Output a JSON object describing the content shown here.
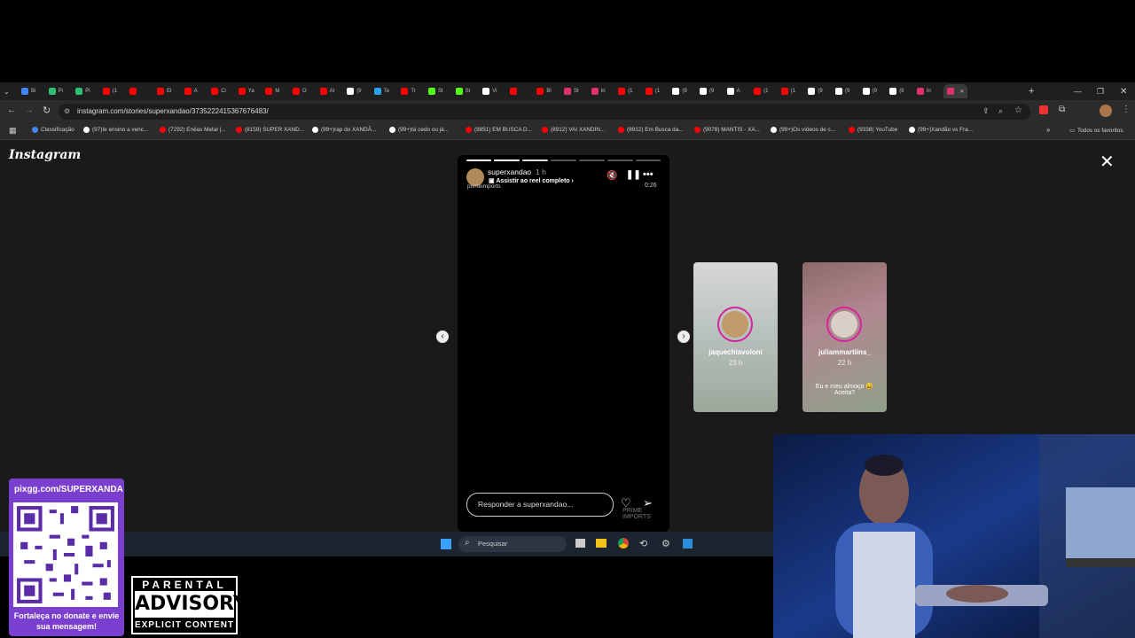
{
  "browser": {
    "tabs": [
      {
        "label": "Bi",
        "color": "#4285f4"
      },
      {
        "label": "Pi",
        "color": "#2fbf71"
      },
      {
        "label": "Pi",
        "color": "#2fbf71"
      },
      {
        "label": "(1",
        "color": "#ff0000"
      },
      {
        "label": "",
        "color": "#ff0000"
      },
      {
        "label": "El",
        "color": "#ff0000"
      },
      {
        "label": "A",
        "color": "#ff0000"
      },
      {
        "label": "Ci",
        "color": "#ff0000"
      },
      {
        "label": "Ya",
        "color": "#ff0000"
      },
      {
        "label": "M",
        "color": "#ff0000"
      },
      {
        "label": "O",
        "color": "#ff0000"
      },
      {
        "label": "Al",
        "color": "#ff0000"
      },
      {
        "label": "(9",
        "color": "#ffffff"
      },
      {
        "label": "Te",
        "color": "#2aa3ef"
      },
      {
        "label": "Tr",
        "color": "#ff0000"
      },
      {
        "label": "St",
        "color": "#53fc18"
      },
      {
        "label": "St",
        "color": "#53fc18"
      },
      {
        "label": "Vi",
        "color": "#ffffff"
      },
      {
        "label": "",
        "color": "#ff0000"
      },
      {
        "label": "Bl",
        "color": "#ff0000"
      },
      {
        "label": "St",
        "color": "#e1306c"
      },
      {
        "label": "In",
        "color": "#e1306c"
      },
      {
        "label": "(1",
        "color": "#ff0000"
      },
      {
        "label": "(1",
        "color": "#ff0000"
      },
      {
        "label": "(9",
        "color": "#ffffff"
      },
      {
        "label": "(9",
        "color": "#ffffff"
      },
      {
        "label": "A",
        "color": "#ffffff"
      },
      {
        "label": "(1",
        "color": "#ff0000"
      },
      {
        "label": "(1",
        "color": "#ff0000"
      },
      {
        "label": "(9",
        "color": "#ffffff"
      },
      {
        "label": "(9",
        "color": "#ffffff"
      },
      {
        "label": "(9",
        "color": "#ffffff"
      },
      {
        "label": "(9",
        "color": "#ffffff"
      },
      {
        "label": "In",
        "color": "#e1306c"
      },
      {
        "label": "",
        "color": "#e1306c"
      }
    ],
    "url": "instagram.com/stories/superxandao/3735222415367676483/",
    "bookmarks": [
      {
        "label": "Classificação",
        "color": "#4285f4"
      },
      {
        "label": "(97)Ie ensino a venc...",
        "color": "#ffffff"
      },
      {
        "label": "(7292) Enéas Metal |...",
        "color": "#ff0000"
      },
      {
        "label": "(8159) SUPER XAND...",
        "color": "#ff0000"
      },
      {
        "label": "(99+)rap do XANDÃ...",
        "color": "#ffffff"
      },
      {
        "label": "(99+)tá cedo ou já...",
        "color": "#ffffff"
      },
      {
        "label": "(8851) EM BUSCA D...",
        "color": "#ff0000"
      },
      {
        "label": "(8912) VAI XANDIN...",
        "color": "#ff0000"
      },
      {
        "label": "(8912) Em Busca da...",
        "color": "#ff0000"
      },
      {
        "label": "(9078) MANTIS - XA...",
        "color": "#ff0000"
      },
      {
        "label": "(99+)Os vídeos de c...",
        "color": "#ffffff"
      },
      {
        "label": "(9338) YouTube",
        "color": "#ff0000"
      },
      {
        "label": "(99+)Xandão vs Fra...",
        "color": "#ffffff"
      }
    ],
    "all_favorites": "Todos os favoritos"
  },
  "instagram": {
    "logo": "Instagram",
    "story": {
      "username": "superxandao",
      "time_ago": "1 h",
      "reel_link": "Assistir ao reel completo",
      "sponsor_text": "primeimports",
      "elapsed": "0:26",
      "reply_placeholder": "Responder a superxandao...",
      "watermark": "PRIME IMPORTS"
    },
    "next_stories": [
      {
        "username": "jaquechiavoloni",
        "time": "23 h"
      },
      {
        "username": "juliammartiins_",
        "time": "22 h",
        "caption": "Eu e meu almoço 😄 Aceita?"
      }
    ]
  },
  "taskbar": {
    "search_label": "Pesquisar"
  },
  "overlay": {
    "pix_url": "pixgg.com/SUPERXANDA",
    "donate_text": "Fortaleça no donate e envie sua mensagem!",
    "advisory": {
      "line1": "PARENTAL",
      "line2": "ADVISORY",
      "line3": "EXPLICIT CONTENT"
    }
  }
}
